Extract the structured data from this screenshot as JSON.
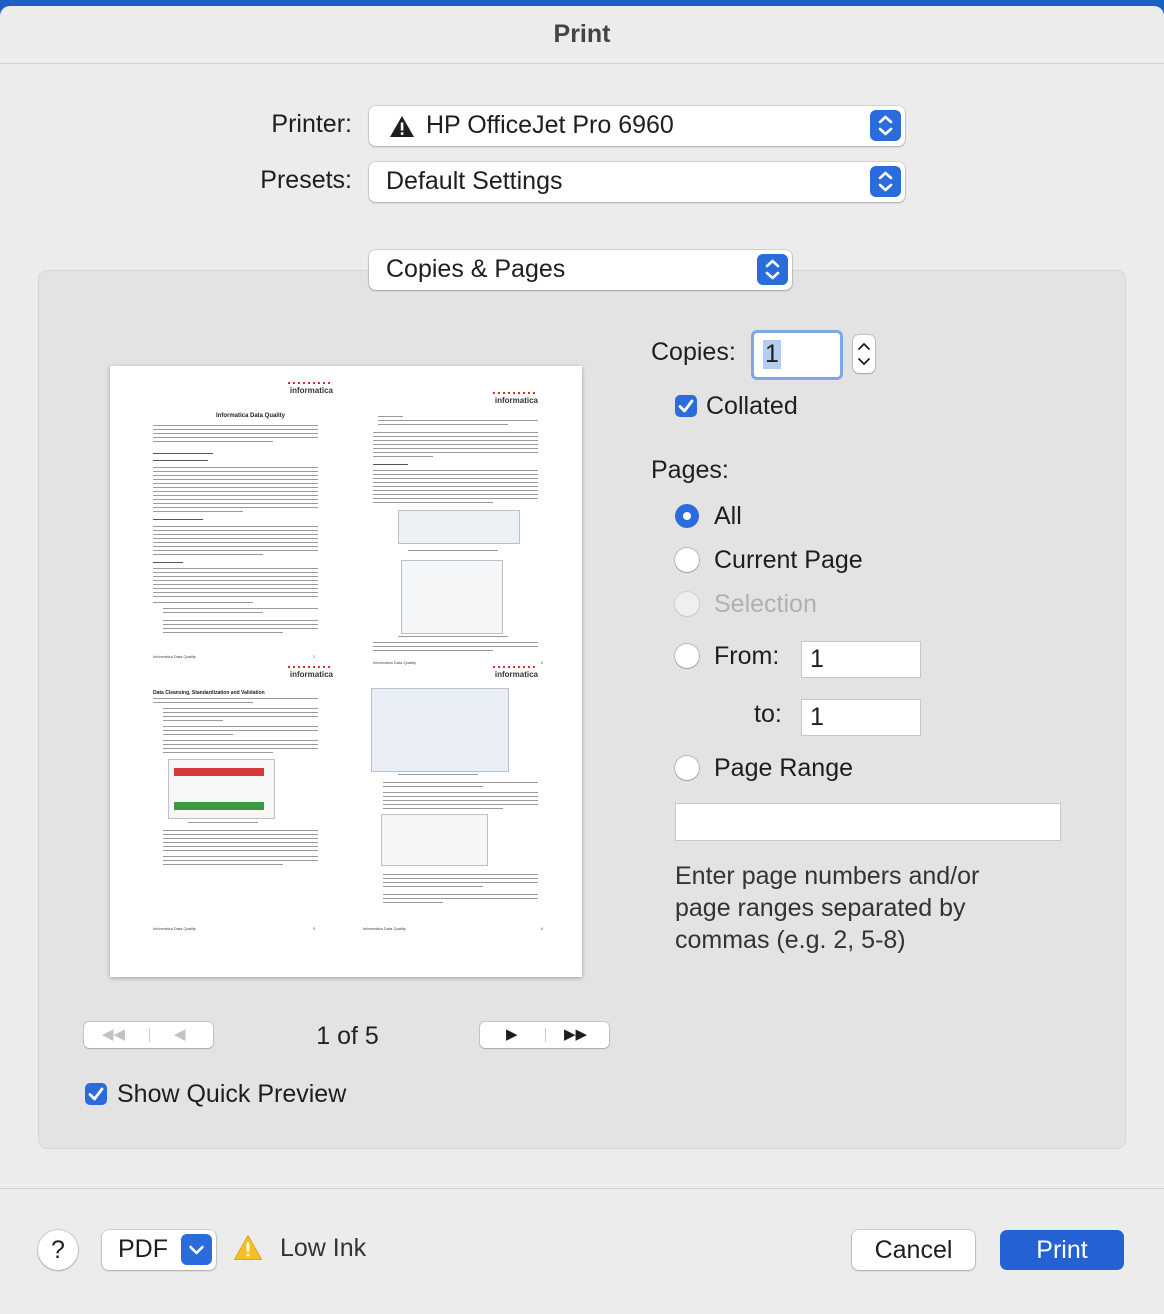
{
  "dialog": {
    "title": "Print"
  },
  "printer": {
    "label": "Printer:",
    "value": "HP OfficeJet Pro 6960"
  },
  "presets": {
    "label": "Presets:",
    "value": "Default Settings"
  },
  "section": {
    "value": "Copies & Pages"
  },
  "preview": {
    "pages": [
      {
        "logo": "informatica",
        "title": "Informatica Data Quality",
        "footer_left": "Informatica Data Quality",
        "footer_right": "1"
      },
      {
        "logo": "informatica",
        "title": "",
        "footer_left": "Informatica Data Quality",
        "footer_right": "2"
      },
      {
        "logo": "informatica",
        "title": "Data Cleansing, Standardization and Validation",
        "footer_left": "Informatica Data Quality",
        "footer_right": "3"
      },
      {
        "logo": "informatica",
        "title": "",
        "footer_left": "Informatica Data Quality",
        "footer_right": "4"
      }
    ],
    "page_indicator": "1 of 5"
  },
  "copies": {
    "label": "Copies:",
    "value": "1"
  },
  "collated": {
    "label": "Collated",
    "checked": true
  },
  "pages": {
    "label": "Pages:",
    "options": {
      "all": "All",
      "current": "Current Page",
      "selection": "Selection",
      "from": "From:",
      "to": "to:",
      "range": "Page Range"
    },
    "selected": "All",
    "from_value": "1",
    "to_value": "1",
    "range_value": "",
    "hint": "Enter page numbers and/or page ranges separated by commas (e.g. 2, 5-8)"
  },
  "show_quick_preview": {
    "label": "Show Quick Preview",
    "checked": true
  },
  "footer": {
    "help": "?",
    "pdf": "PDF",
    "status": "Low Ink",
    "cancel": "Cancel",
    "print": "Print"
  },
  "colors": {
    "accent": "#2a6cdb",
    "warning": "#f4c025",
    "print_button": "#2461d3"
  }
}
